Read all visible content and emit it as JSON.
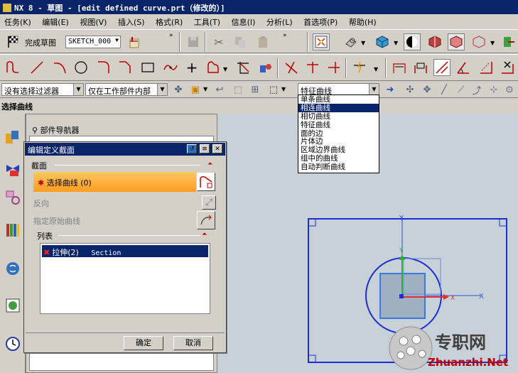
{
  "window": {
    "title": "NX 8 - 草图 - [edit defined curve.prt（修改的）]"
  },
  "menubar": {
    "items": [
      "任务(K)",
      "编辑(E)",
      "视图(V)",
      "插入(S)",
      "格式(R)",
      "工具(T)",
      "信息(I)",
      "分析(L)",
      "首选项(P)",
      "帮助(H)"
    ]
  },
  "sketch_toolbar": {
    "finish_sketch_label": "完成草图",
    "sketch_name": "SKETCH_000"
  },
  "filter_bar": {
    "selection_filter": "没有选择过滤器",
    "scope": "仅在工作部件内部",
    "curve_rule": "特征曲线"
  },
  "curve_rule_dropdown": {
    "options": [
      "单条曲线",
      "相连曲线",
      "相切曲线",
      "特征曲线",
      "面的边",
      "片体边",
      "区域边界曲线",
      "组中的曲线",
      "自动判断曲线"
    ],
    "highlighted_index": 1
  },
  "status": {
    "prompt": "选择曲线"
  },
  "navigator": {
    "title": "部件导航器"
  },
  "dialog": {
    "title": "编辑定义截面",
    "section_group": "截面",
    "select_curve_label": "选择曲线 (0)",
    "reverse_label": "反向",
    "specify_origin_label": "指定原始曲线",
    "list_group": "列表",
    "list_rows": [
      {
        "feature": "拉伸(2)",
        "name": "Section"
      }
    ],
    "ok_label": "确定",
    "cancel_label": "取消"
  },
  "colors": {
    "title_bar": "#0a246a",
    "highlight": "#0a246a",
    "active_field": "#ffa53a",
    "sketch_blue": "#1b2fd6",
    "square_fill": "#9fb0c2"
  },
  "watermark": {
    "brand": "专职网",
    "url": "Zhuanzhi.Net"
  }
}
